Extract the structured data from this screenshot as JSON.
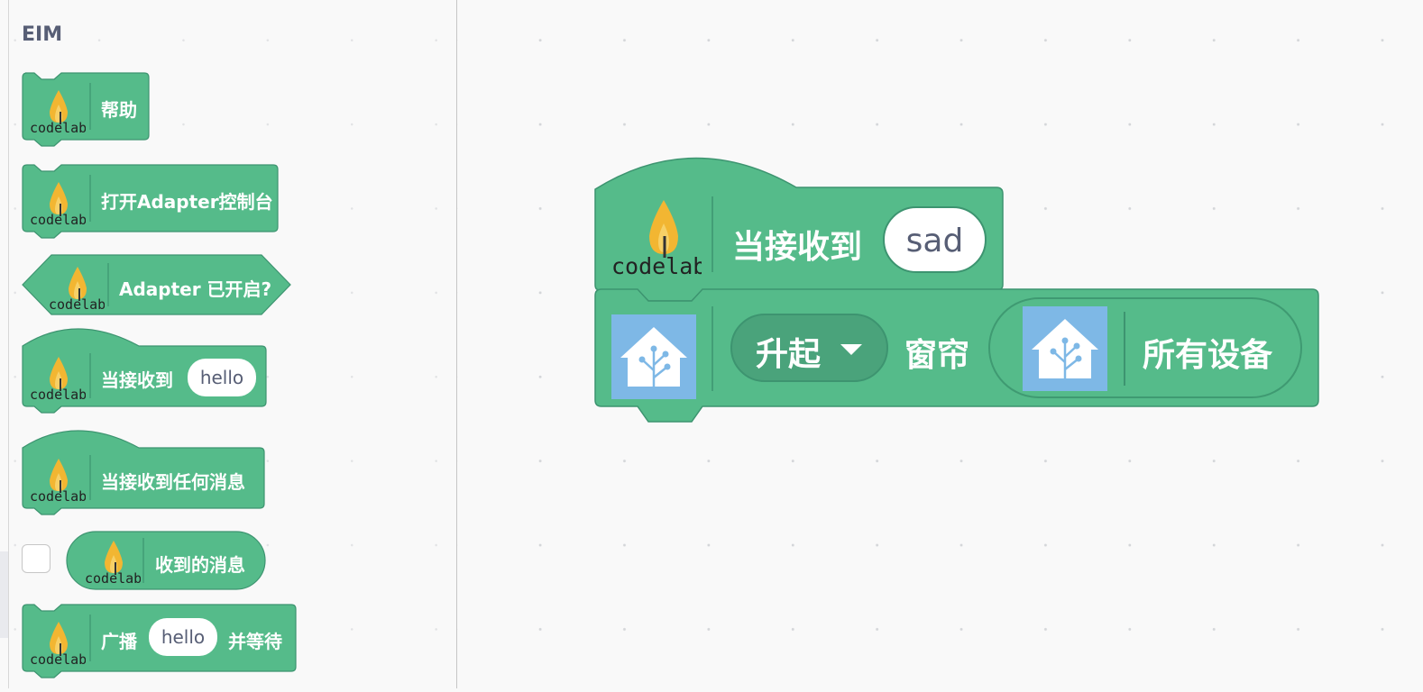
{
  "category": {
    "title": "EIM"
  },
  "palette": {
    "block_color": "#55bb8a",
    "block_border": "#3d9470",
    "dropdown_color": "#4aa37b",
    "codelab_flame_color": "#f2b632",
    "homeassistant_icon_bg": "#7eb8e6"
  },
  "flyout_blocks": [
    {
      "label": "帮助",
      "icon": "codelab-logo-icon"
    },
    {
      "label": "打开Adapter控制台",
      "icon": "codelab-logo-icon"
    },
    {
      "label": "Adapter 已开启?",
      "icon": "codelab-logo-icon"
    },
    {
      "label": "当接收到",
      "input": "hello",
      "icon": "codelab-logo-icon"
    },
    {
      "label": "当接收到任何消息",
      "icon": "codelab-logo-icon"
    },
    {
      "label": "收到的消息",
      "icon": "codelab-logo-icon",
      "checkbox": false
    },
    {
      "label_before": "广播",
      "input": "hello",
      "label_after": "并等待",
      "icon": "codelab-logo-icon"
    }
  ],
  "workspace": {
    "hat_block": {
      "label": "当接收到",
      "input": "sad",
      "icon": "codelab-logo-icon"
    },
    "command_block": {
      "icon": "home-assistant-icon",
      "dropdown_value": "升起",
      "label": "窗帘",
      "reporter": {
        "icon": "home-assistant-icon",
        "label": "所有设备"
      }
    }
  }
}
